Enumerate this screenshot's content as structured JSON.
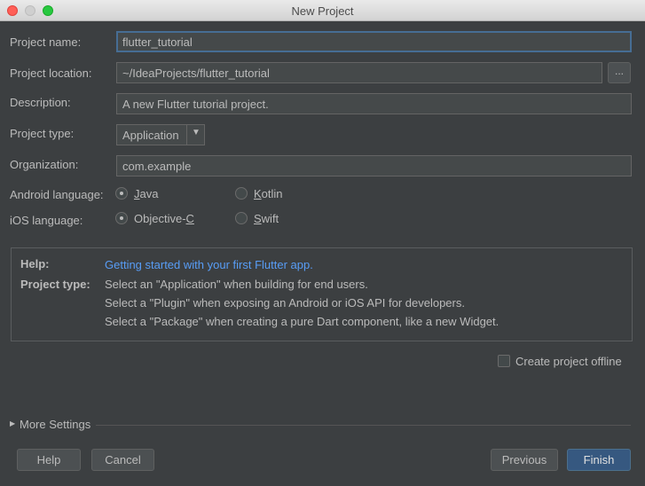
{
  "window": {
    "title": "New Project"
  },
  "form": {
    "project_name": {
      "label": "Project name:",
      "value": "flutter_tutorial"
    },
    "project_location": {
      "label": "Project location:",
      "value": "~/IdeaProjects/flutter_tutorial",
      "browse_label": "..."
    },
    "description": {
      "label": "Description:",
      "value": "A new Flutter tutorial project."
    },
    "project_type": {
      "label": "Project type:",
      "selected": "Application"
    },
    "organization": {
      "label": "Organization:",
      "value": "com.example"
    },
    "android_language": {
      "label": "Android language:",
      "options": [
        {
          "pre": "",
          "mnemonic": "J",
          "post": "ava",
          "selected": true
        },
        {
          "pre": "",
          "mnemonic": "K",
          "post": "otlin",
          "selected": false
        }
      ]
    },
    "ios_language": {
      "label": "iOS language:",
      "options": [
        {
          "pre": "Objective-",
          "mnemonic": "C",
          "post": "",
          "selected": true
        },
        {
          "pre": "",
          "mnemonic": "S",
          "post": "wift",
          "selected": false
        }
      ]
    }
  },
  "help": {
    "help_label": "Help:",
    "help_link": "Getting started with your first Flutter app.",
    "type_label": "Project type:",
    "lines": [
      "Select an \"Application\" when building for end users.",
      "Select a \"Plugin\" when exposing an Android or iOS API for developers.",
      "Select a \"Package\" when creating a pure Dart component, like a new Widget."
    ]
  },
  "offline": {
    "label": "Create project offline",
    "checked": false
  },
  "more_settings": {
    "label": "More Settings"
  },
  "buttons": {
    "help": "Help",
    "cancel": "Cancel",
    "previous": "Previous",
    "finish": "Finish"
  },
  "colors": {
    "accent": "#365880",
    "link": "#589df6",
    "background": "#3c3f41"
  }
}
